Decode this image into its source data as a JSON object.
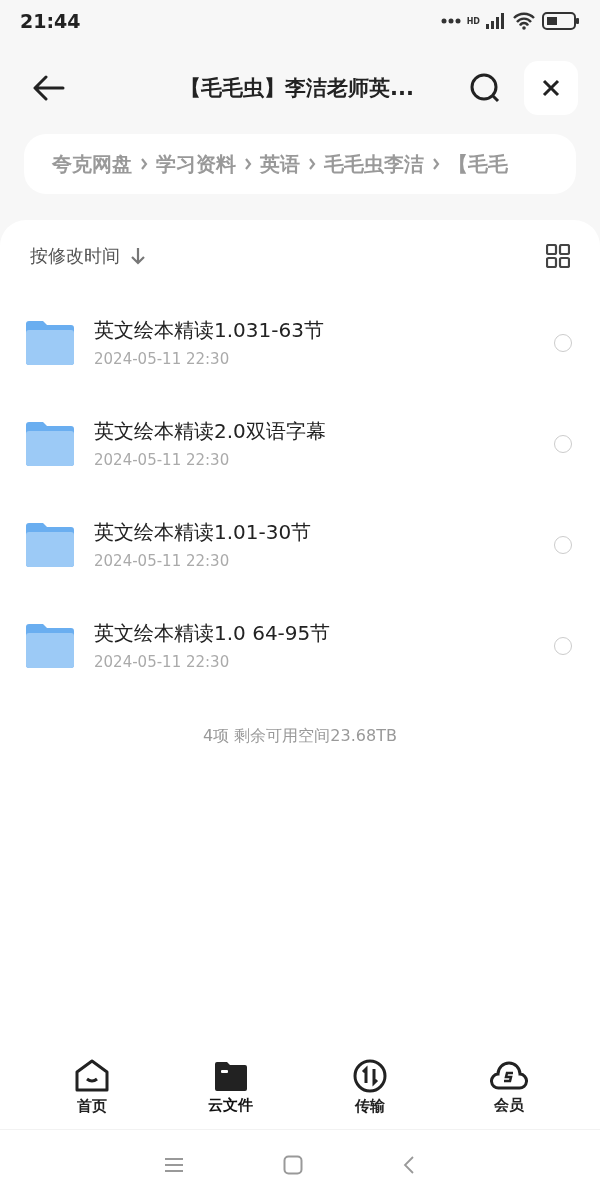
{
  "status_bar": {
    "time": "21:44",
    "network_label": "HD"
  },
  "header": {
    "title": "【毛毛虫】李洁老师英..."
  },
  "breadcrumb": [
    "夸克网盘",
    "学习资料",
    "英语",
    "毛毛虫李洁",
    "【毛毛"
  ],
  "sort": {
    "label": "按修改时间"
  },
  "files": [
    {
      "name": "英文绘本精读1.031-63节",
      "date": "2024-05-11 22:30",
      "selected": false
    },
    {
      "name": "英文绘本精读2.0双语字幕",
      "date": "2024-05-11 22:30",
      "selected": false
    },
    {
      "name": "英文绘本精读1.01-30节",
      "date": "2024-05-11 22:30",
      "selected": false
    },
    {
      "name": "英文绘本精读1.0 64-95节",
      "date": "2024-05-11 22:30",
      "selected": false
    }
  ],
  "summary": "4项 剩余可用空间23.68TB",
  "tabs": [
    {
      "kind": "home",
      "label": "首页",
      "selected": false
    },
    {
      "kind": "files",
      "label": "云文件",
      "selected": true
    },
    {
      "kind": "transfer",
      "label": "传输",
      "selected": false
    },
    {
      "kind": "member",
      "label": "会员",
      "selected": false
    }
  ]
}
